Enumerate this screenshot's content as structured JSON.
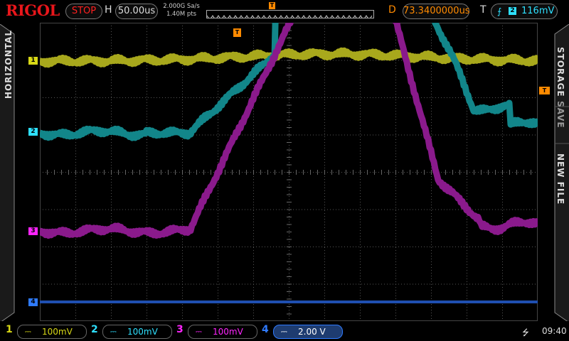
{
  "brand": "RIGOL",
  "run_state": "STOP",
  "horizontal": {
    "label": "H",
    "timebase": "50.00us",
    "sample_rate": "2.000G Sa/s",
    "memory_depth": "1.40M pts"
  },
  "delay": {
    "label": "D",
    "value": "73.3400000us"
  },
  "trigger": {
    "label": "T",
    "source": "2",
    "level": "116mV",
    "marker": "T"
  },
  "side_tabs": {
    "left": "HORIZONTAL",
    "right_top": "STORAGE",
    "right_mid": "SAVE",
    "right_bottom": "NEW FILE"
  },
  "channels": [
    {
      "num": "1",
      "color": "#d8d816",
      "trace_color": "#a8a81c",
      "coupling": "⎓",
      "scale": "100mV",
      "active": false
    },
    {
      "num": "2",
      "color": "#2ee0ff",
      "trace_color": "#12868a",
      "coupling": "⎓",
      "scale": "100mV",
      "active": false
    },
    {
      "num": "3",
      "color": "#ff24ff",
      "trace_color": "#8a1a8c",
      "coupling": "⎓",
      "scale": "100mV",
      "active": false
    },
    {
      "num": "4",
      "color": "#2f7bff",
      "trace_color": "#1f4fb0",
      "coupling": "⎓",
      "scale": "2.00 V",
      "active": true
    }
  ],
  "system": {
    "usb_icon": "usb-icon",
    "time": "09:40"
  }
}
